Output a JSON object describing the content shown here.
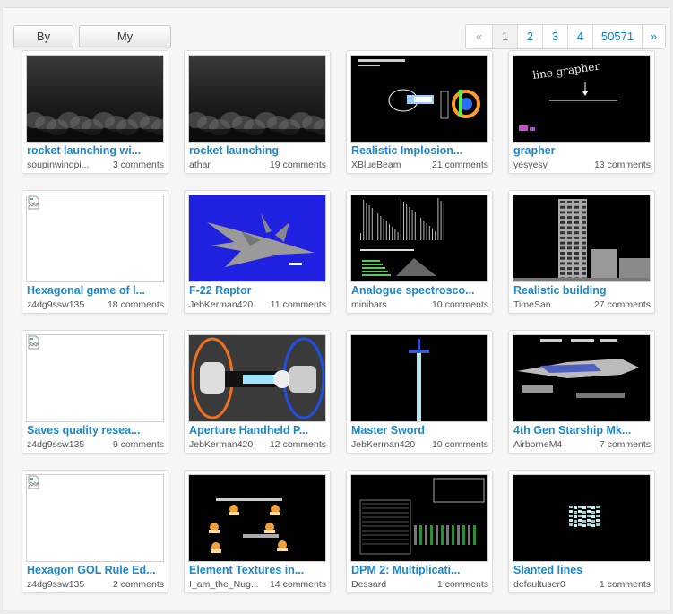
{
  "toolbar": {
    "by_date_label": "By Date",
    "favourites_label": "My Favourites"
  },
  "pagination": {
    "prev": "«",
    "pages": [
      "1",
      "2",
      "3",
      "4",
      "50571"
    ],
    "next": "»",
    "current": "1"
  },
  "saves": [
    {
      "title": "rocket launching wi...",
      "author": "soupinwindpi...",
      "comments": "3 comments",
      "thumb": "smoke-icon"
    },
    {
      "title": "rocket launching",
      "author": "athar",
      "comments": "19 comments",
      "thumb": "smoke-icon"
    },
    {
      "title": "Realistic Implosion...",
      "author": "XBlueBeam",
      "comments": "21 comments",
      "thumb": "implosion-icon"
    },
    {
      "title": "grapher",
      "author": "yesyesy",
      "comments": "13 comments",
      "thumb": "grapher-icon"
    },
    {
      "title": "Hexagonal game of l...",
      "author": "z4dg9ssw135",
      "comments": "18 comments",
      "thumb": "broken-image-icon"
    },
    {
      "title": "F-22 Raptor",
      "author": "JebKerman420",
      "comments": "11 comments",
      "thumb": "jet-icon"
    },
    {
      "title": "Analogue spectrosco...",
      "author": "minihars",
      "comments": "10 comments",
      "thumb": "spectroscope-icon"
    },
    {
      "title": "Realistic building",
      "author": "TimeSan",
      "comments": "27 comments",
      "thumb": "building-icon"
    },
    {
      "title": "Saves quality resea...",
      "author": "z4dg9ssw135",
      "comments": "9 comments",
      "thumb": "broken-image-icon"
    },
    {
      "title": "Aperture Handheld P...",
      "author": "JebKerman420",
      "comments": "12 comments",
      "thumb": "portal-gun-icon"
    },
    {
      "title": "Master Sword",
      "author": "JebKerman420",
      "comments": "10 comments",
      "thumb": "sword-icon"
    },
    {
      "title": "4th Gen Starship Mk...",
      "author": "AirborneM4",
      "comments": "7 comments",
      "thumb": "starship-icon"
    },
    {
      "title": "Hexagon GOL Rule Ed...",
      "author": "z4dg9ssw135",
      "comments": "2 comments",
      "thumb": "broken-image-icon"
    },
    {
      "title": "Element Textures in...",
      "author": "I_am_the_Nug...",
      "comments": "14 comments",
      "thumb": "textures-icon"
    },
    {
      "title": "DPM 2: Multiplicati...",
      "author": "Dessard",
      "comments": "1 comments",
      "thumb": "circuit-icon"
    },
    {
      "title": "Slanted lines",
      "author": "defaultuser0",
      "comments": "1 comments",
      "thumb": "slanted-lines-icon"
    }
  ],
  "thumb_text": {
    "grapher": "line grapher"
  }
}
